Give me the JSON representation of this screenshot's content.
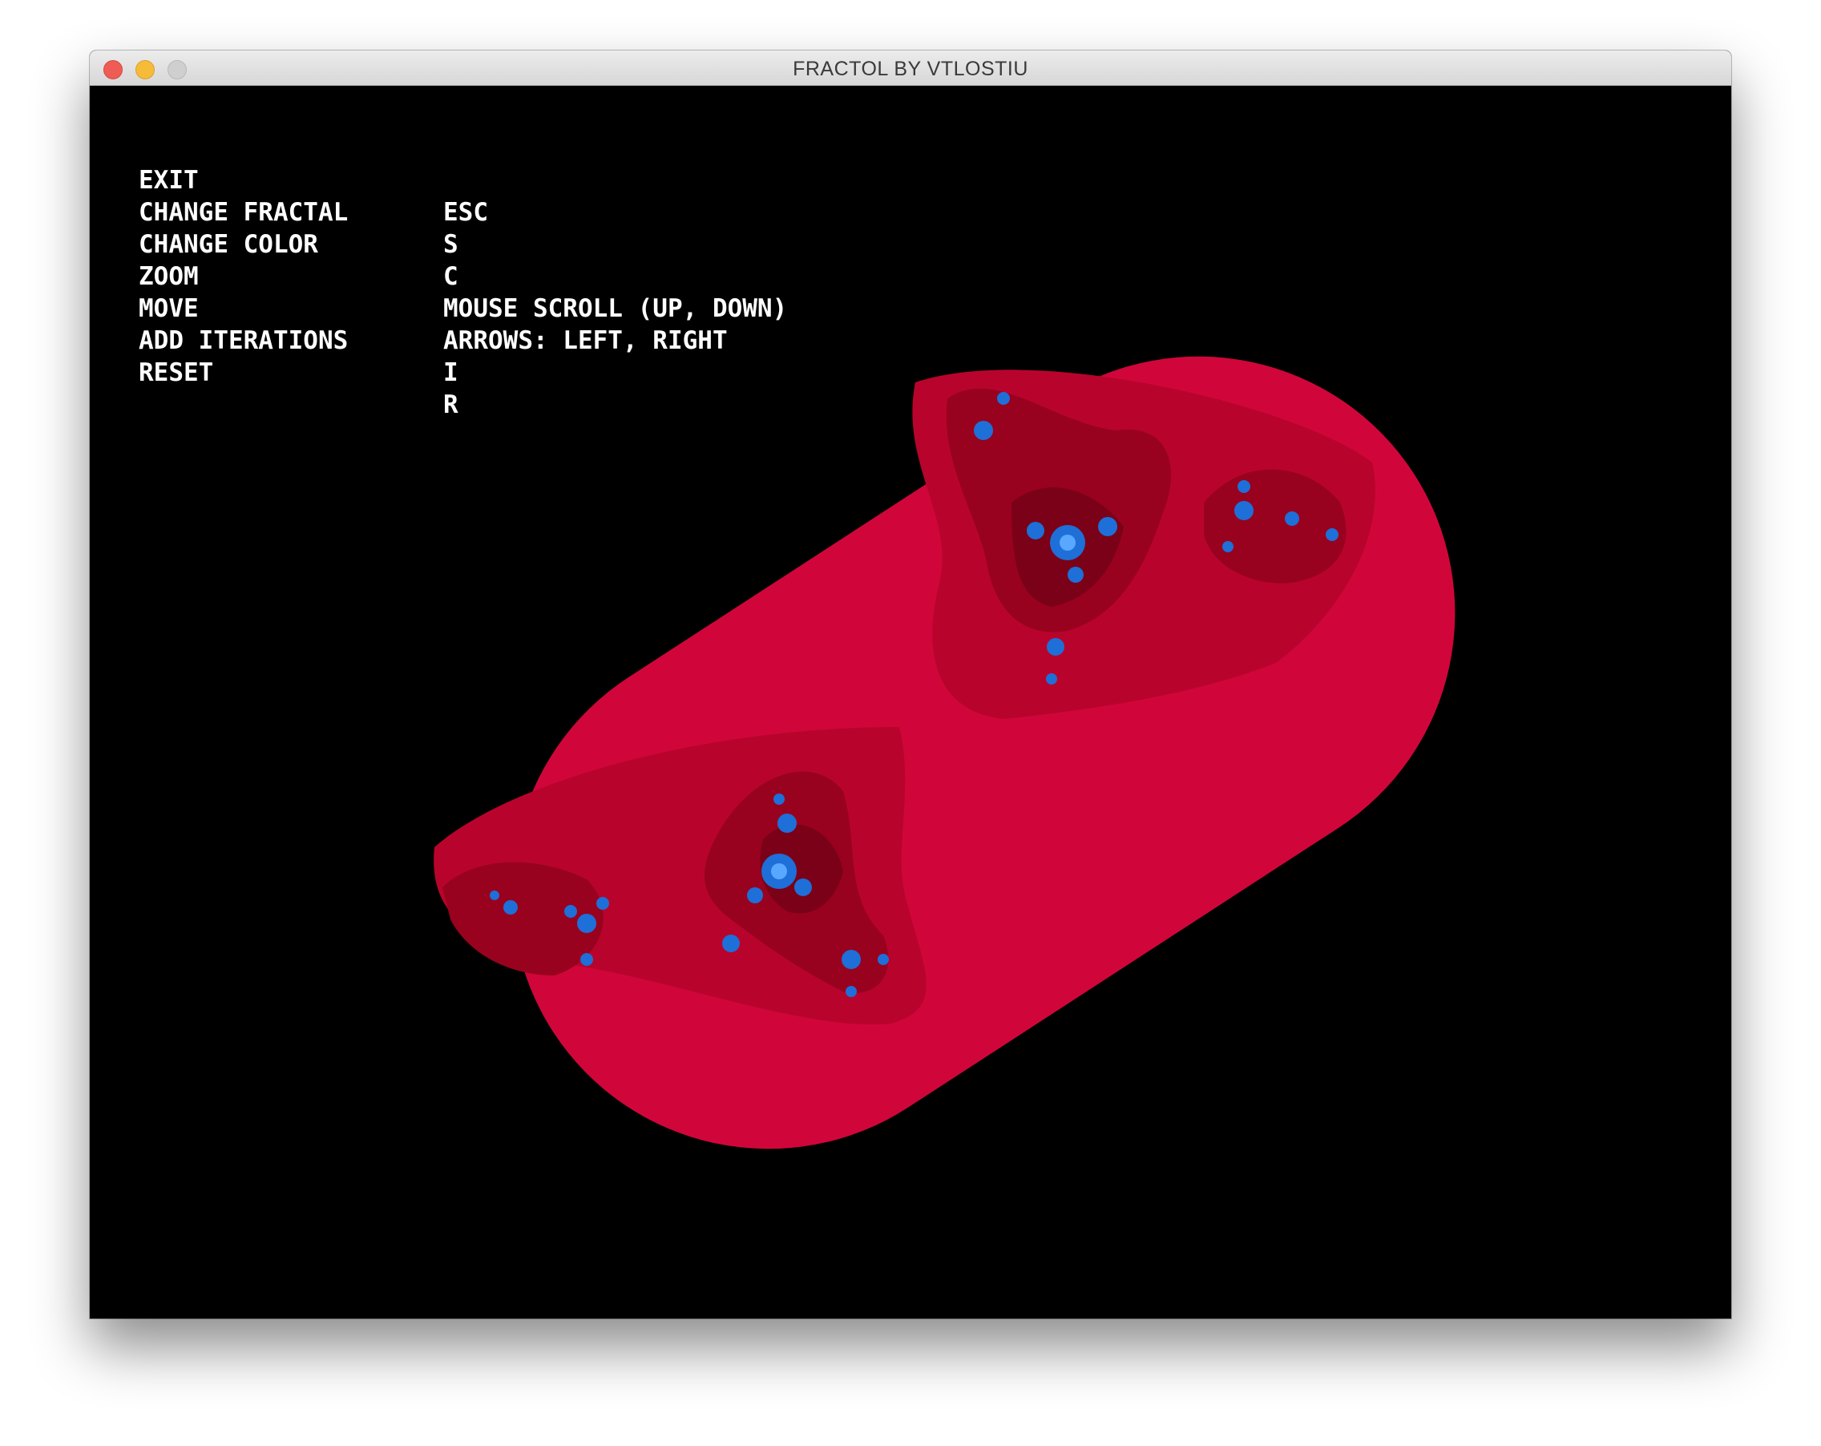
{
  "window": {
    "title": "FRACTOL BY VTLOSTIU"
  },
  "help": {
    "rows": [
      {
        "action": "EXIT",
        "key": "ESC"
      },
      {
        "action": "CHANGE FRACTAL",
        "key": "S"
      },
      {
        "action": "CHANGE COLOR",
        "key": "C"
      },
      {
        "action": "ZOOM",
        "key": "MOUSE SCROLL (UP, DOWN)"
      },
      {
        "action": "MOVE",
        "key": "ARROWS: LEFT, RIGHT"
      },
      {
        "action": "ADD ITERATIONS",
        "key": "I"
      },
      {
        "action": "RESET",
        "key": "R"
      }
    ]
  },
  "colors": {
    "background": "#000000",
    "outer": "#d0063a",
    "band2": "#b8042c",
    "band3": "#98021f",
    "band4": "#7a0118",
    "core": "#1e6fd8",
    "core_highlight": "#58a8ff"
  }
}
